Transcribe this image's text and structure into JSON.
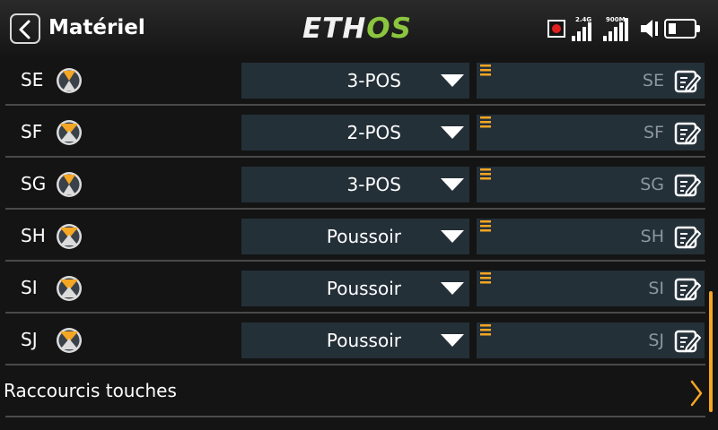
{
  "header": {
    "title": "Matériel",
    "logo_part1": "ETH",
    "logo_part2": "OS",
    "status": {
      "rf_label_1": "2.4G",
      "rf_label_2": "900M"
    }
  },
  "switches": [
    {
      "name": "SE",
      "type": "3-POS",
      "function": "SE",
      "icon": "three-position-switch-icon"
    },
    {
      "name": "SF",
      "type": "2-POS",
      "function": "SF",
      "icon": "two-position-switch-icon"
    },
    {
      "name": "SG",
      "type": "3-POS",
      "function": "SG",
      "icon": "three-position-switch-icon"
    },
    {
      "name": "SH",
      "type": "Poussoir",
      "function": "SH",
      "icon": "two-position-switch-icon"
    },
    {
      "name": "SI",
      "type": "Poussoir",
      "function": "SI",
      "icon": "two-position-switch-icon"
    },
    {
      "name": "SJ",
      "type": "Poussoir",
      "function": "SJ",
      "icon": "two-position-switch-icon"
    }
  ],
  "shortcut": {
    "label": "Raccourcis touches"
  },
  "colors": {
    "accent": "#f5a623",
    "field_bg": "#243038",
    "logo_green": "#8bc53f",
    "record": "#e01f1f"
  }
}
